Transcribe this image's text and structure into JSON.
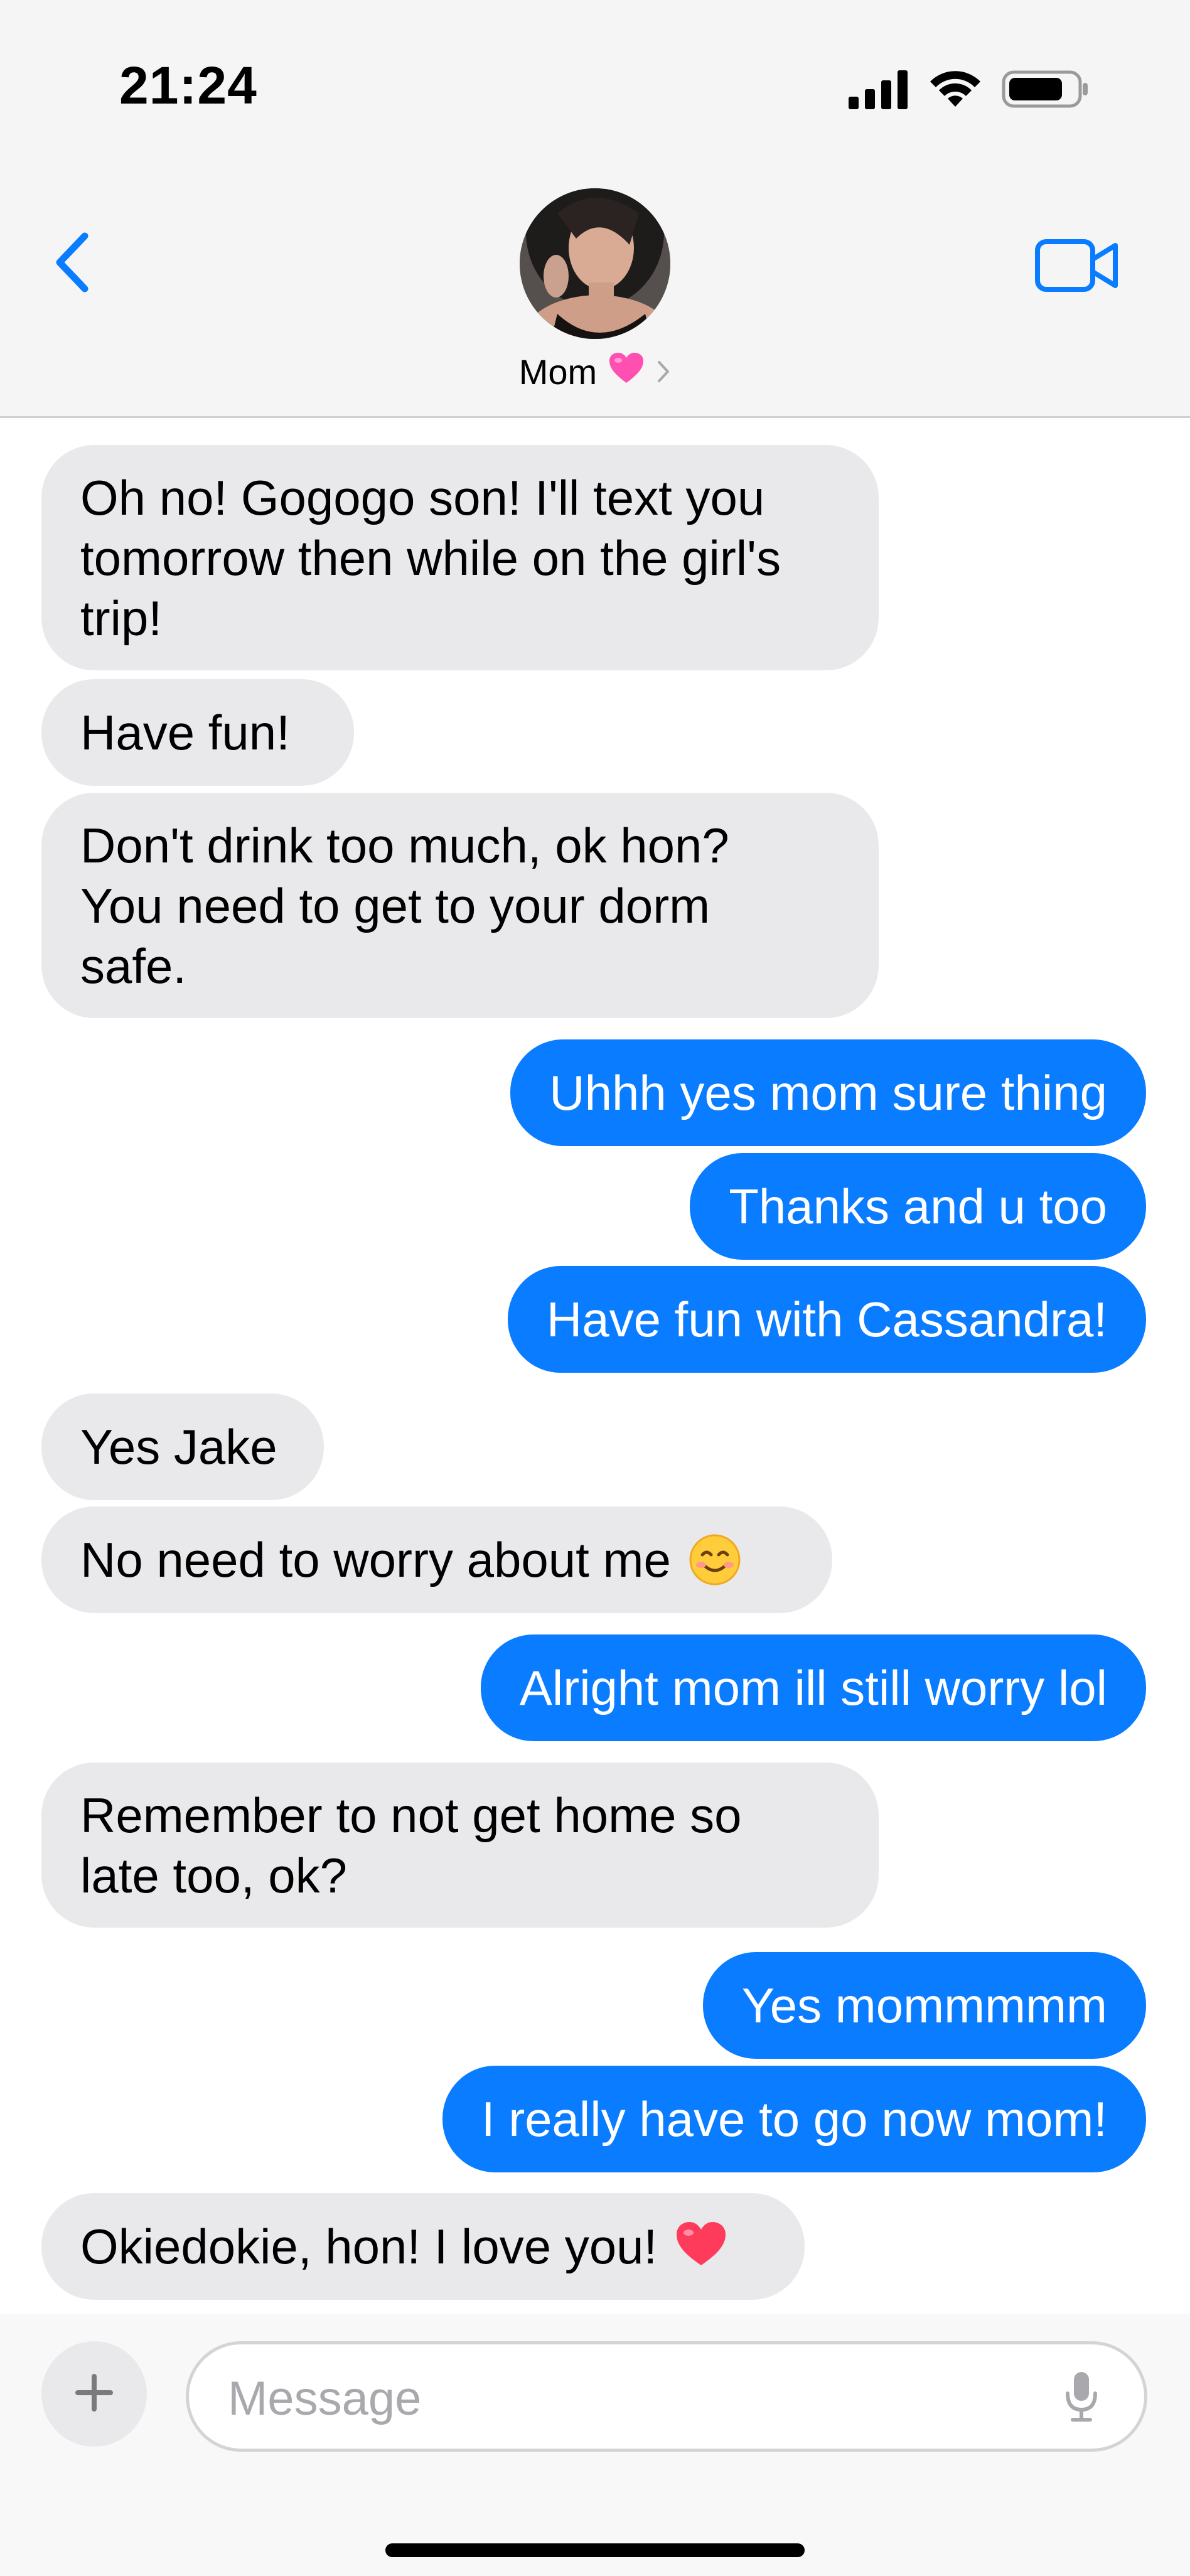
{
  "status_bar": {
    "time": "21:24",
    "icons": [
      "cellular-signal-icon",
      "wifi-icon",
      "battery-icon"
    ]
  },
  "header": {
    "back_icon": "chevron-left-icon",
    "contact_name": "Mom",
    "contact_emoji": "pink-heart-icon",
    "chevron": "chevron-right-icon",
    "video_icon": "video-camera-icon"
  },
  "messages": [
    {
      "from": "them",
      "text": "Oh no! Gogogo son! I'll text you\ntomorrow then while on the girl's\ntrip!"
    },
    {
      "from": "them",
      "text": "Have fun!"
    },
    {
      "from": "them",
      "text": "Don't drink too much, ok hon?\nYou need to get to your dorm\nsafe."
    },
    {
      "from": "me",
      "text": "Uhhh yes mom sure thing"
    },
    {
      "from": "me",
      "text": "Thanks and u too"
    },
    {
      "from": "me",
      "text": "Have fun with Cassandra!"
    },
    {
      "from": "them",
      "text": "Yes Jake"
    },
    {
      "from": "them",
      "text": "No need to worry about me",
      "emoji": "smiling-face-emoji"
    },
    {
      "from": "me",
      "text": "Alright mom ill still worry lol"
    },
    {
      "from": "them",
      "text": "Remember to not get home so\nlate too, ok?"
    },
    {
      "from": "me",
      "text": "Yes mommmmm"
    },
    {
      "from": "me",
      "text": "I really have to go now mom!"
    },
    {
      "from": "them",
      "text": "Okiedokie, hon! I love you!",
      "emoji": "red-heart-emoji"
    }
  ],
  "composer": {
    "plus_icon": "plus-icon",
    "placeholder": "Message",
    "value": "",
    "mic_icon": "microphone-icon"
  },
  "colors": {
    "outgoing_bubble": "#0a7cff",
    "incoming_bubble": "#e9e9eb",
    "accent": "#0a7cff",
    "heart_pink": "#ff4fb0",
    "heart_red": "#ff3b5c"
  }
}
